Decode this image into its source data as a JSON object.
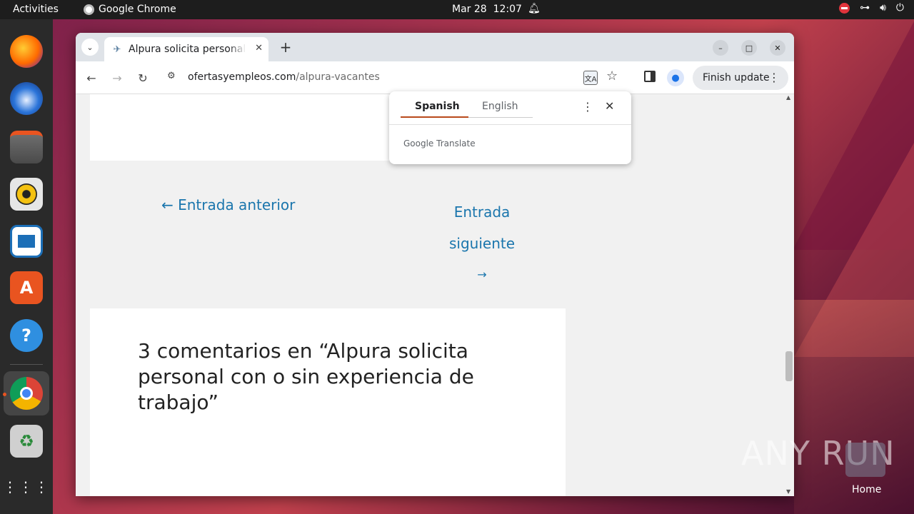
{
  "topbar": {
    "activities": "Activities",
    "app_name": "Google Chrome",
    "date": "Mar 28",
    "time": "12:07"
  },
  "dock": {
    "items": [
      "firefox-icon",
      "thunderbird-icon",
      "files-icon",
      "rhythmbox-icon",
      "writer-icon",
      "app-center-icon",
      "help-icon",
      "chrome-icon",
      "trash-icon",
      "show-apps-icon"
    ]
  },
  "browser": {
    "tab_title": "Alpura solicita personal con o sin experiencia",
    "url_domain": "ofertasyempleos.com",
    "url_path": "/alpura-vacantes",
    "finish_update": "Finish update"
  },
  "translate_popup": {
    "source_lang": "Spanish",
    "target_lang": "English",
    "brand": "Google Translate"
  },
  "page": {
    "prev_post": "← Entrada anterior",
    "next_post_line1": "Entrada",
    "next_post_line2": "siguiente",
    "next_arrow": "→",
    "comments_title": "3 comentarios en “Alpura solicita personal con o sin experiencia de trabajo”"
  },
  "desktop": {
    "watermark": "ANY RUN",
    "home_label": "Home"
  },
  "colors": {
    "link": "#1b76ad",
    "accent_underline": "#b94a1b",
    "topbar": "#1d1d1d"
  }
}
